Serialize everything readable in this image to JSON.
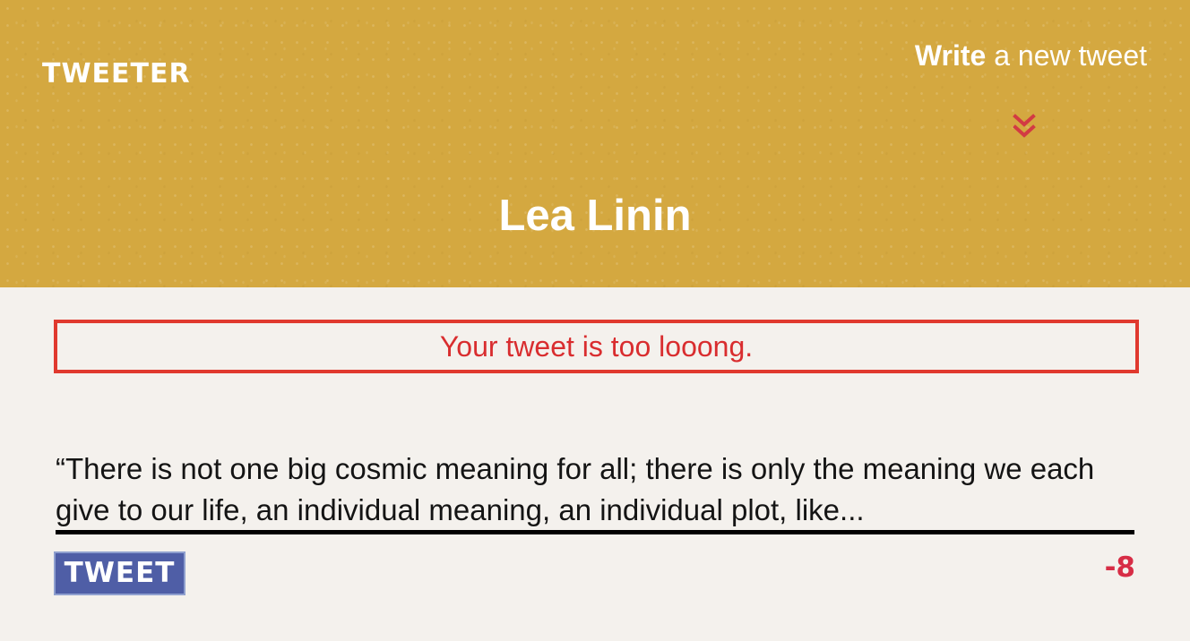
{
  "header": {
    "logo": "TWEETER",
    "compose_link": {
      "emphasis": "Write",
      "rest": " a new tweet"
    },
    "compose_icon": "double-chevron-down-icon",
    "profile_name": "Lea Linin"
  },
  "composer": {
    "error_message": "Your tweet is too looong.",
    "tweet_text": "“There is not one big cosmic meaning for all; there is only the meaning we each give to our life, an individual meaning, an individual plot, like...",
    "submit_label": "TWEET",
    "character_counter": "-8"
  },
  "colors": {
    "header_background": "#d4a840",
    "page_background": "#f4f1ed",
    "error": "#e0392e",
    "button": "#4f5ea6",
    "counter": "#d72d46",
    "chevron": "#d23a43"
  }
}
